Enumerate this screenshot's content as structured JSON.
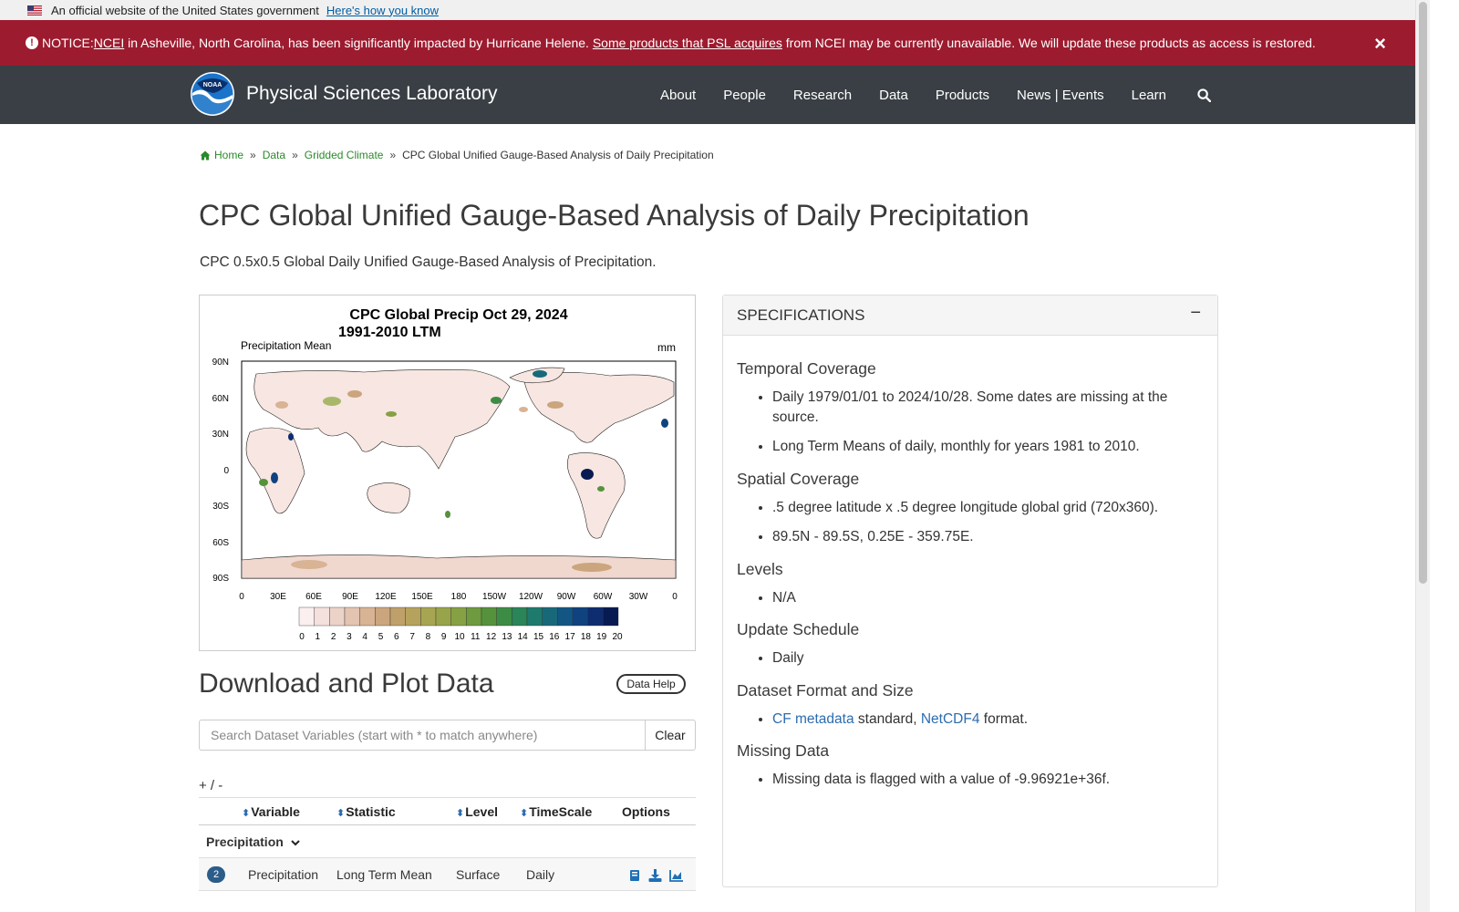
{
  "gov_banner": {
    "text": "An official website of the United States government",
    "link": "Here's how you know"
  },
  "notice": {
    "prefix": "NOTICE: ",
    "ncei_link": "NCEI",
    "text_1": " in Asheville, North Carolina, has been significantly impacted by Hurricane Helene. ",
    "products_link": "Some products that PSL acquires",
    "text_2": " from NCEI may be currently unavailable. We will update these products as access is restored.",
    "close": "×"
  },
  "header": {
    "logo_text": "NOAA",
    "title": "Physical Sciences Laboratory",
    "nav": [
      "About",
      "People",
      "Research",
      "Data",
      "Products",
      "News | Events",
      "Learn"
    ]
  },
  "breadcrumb": {
    "home": "Home",
    "data": "Data",
    "gridded": "Gridded Climate",
    "current": "CPC Global Unified Gauge-Based Analysis of Daily Precipitation",
    "separator": "»"
  },
  "page": {
    "title": "CPC Global Unified Gauge-Based Analysis of Daily Precipitation",
    "lead": "CPC 0.5x0.5 Global Daily Unified Gauge-Based Analysis of Precipitation."
  },
  "plot": {
    "title_line1": "CPC Global Precip Oct 29, 2024",
    "title_line2": "1991-2010 LTM",
    "left_label": "Precipitation Mean",
    "right_label": "mm",
    "lat_labels": [
      "90N",
      "60N",
      "30N",
      "0",
      "30S",
      "60S",
      "90S"
    ],
    "lon_labels": [
      "0",
      "30E",
      "60E",
      "90E",
      "120E",
      "150E",
      "180",
      "150W",
      "120W",
      "90W",
      "60W",
      "30W",
      "0"
    ],
    "colorbar_labels": [
      "0",
      "1",
      "2",
      "3",
      "4",
      "5",
      "6",
      "7",
      "8",
      "9",
      "10",
      "11",
      "12",
      "13",
      "14",
      "15",
      "16",
      "17",
      "18",
      "19",
      "20"
    ],
    "colorbar_colors": [
      "#fbf0ef",
      "#f4e0dc",
      "#ecd3c8",
      "#e3c4b0",
      "#d8b394",
      "#cba57d",
      "#bfa06a",
      "#b5a25d",
      "#a8a552",
      "#98a44a",
      "#86a044",
      "#6f9a3f",
      "#56923c",
      "#3d8c45",
      "#2a8558",
      "#1d7a6c",
      "#17697a",
      "#135684",
      "#10427f",
      "#0d2d70",
      "#081a52"
    ]
  },
  "download": {
    "title": "Download and Plot Data",
    "help_button": "Data Help",
    "search_placeholder": "Search Dataset Variables (start with * to match anywhere)",
    "clear_button": "Clear",
    "expand_toggle": "+ / -",
    "columns": [
      "Variable",
      "Statistic",
      "Level",
      "TimeScale",
      "Options"
    ],
    "group": "Precipitation",
    "row": {
      "count": "2",
      "variable": "Precipitation",
      "statistic": "Long Term Mean",
      "level": "Surface",
      "timescale": "Daily"
    }
  },
  "specs": {
    "header": "SPECIFICATIONS",
    "collapse": "−",
    "temporal_title": "Temporal Coverage",
    "temporal_items": [
      "Daily 1979/01/01 to 2024/10/28. Some dates are missing at the source.",
      "Long Term Means of daily, monthly for years 1981 to 2010."
    ],
    "spatial_title": "Spatial Coverage",
    "spatial_items": [
      ".5 degree latitude x .5 degree longitude global grid (720x360).",
      "89.5N - 89.5S, 0.25E - 359.75E."
    ],
    "levels_title": "Levels",
    "levels_items": [
      "N/A"
    ],
    "update_title": "Update Schedule",
    "update_items": [
      "Daily"
    ],
    "format_title": "Dataset Format and Size",
    "format_cf": "CF metadata",
    "format_mid": " standard, ",
    "format_netcdf": "NetCDF4",
    "format_end": " format.",
    "missing_title": "Missing Data",
    "missing_items": [
      "Missing data is flagged with a value of -9.96921e+36f."
    ]
  },
  "colors": {
    "notice_bg": "#9d1b2f",
    "navbar_bg": "#393f44",
    "link_green": "#2b8a2b",
    "link_blue": "#2b6cb0"
  }
}
